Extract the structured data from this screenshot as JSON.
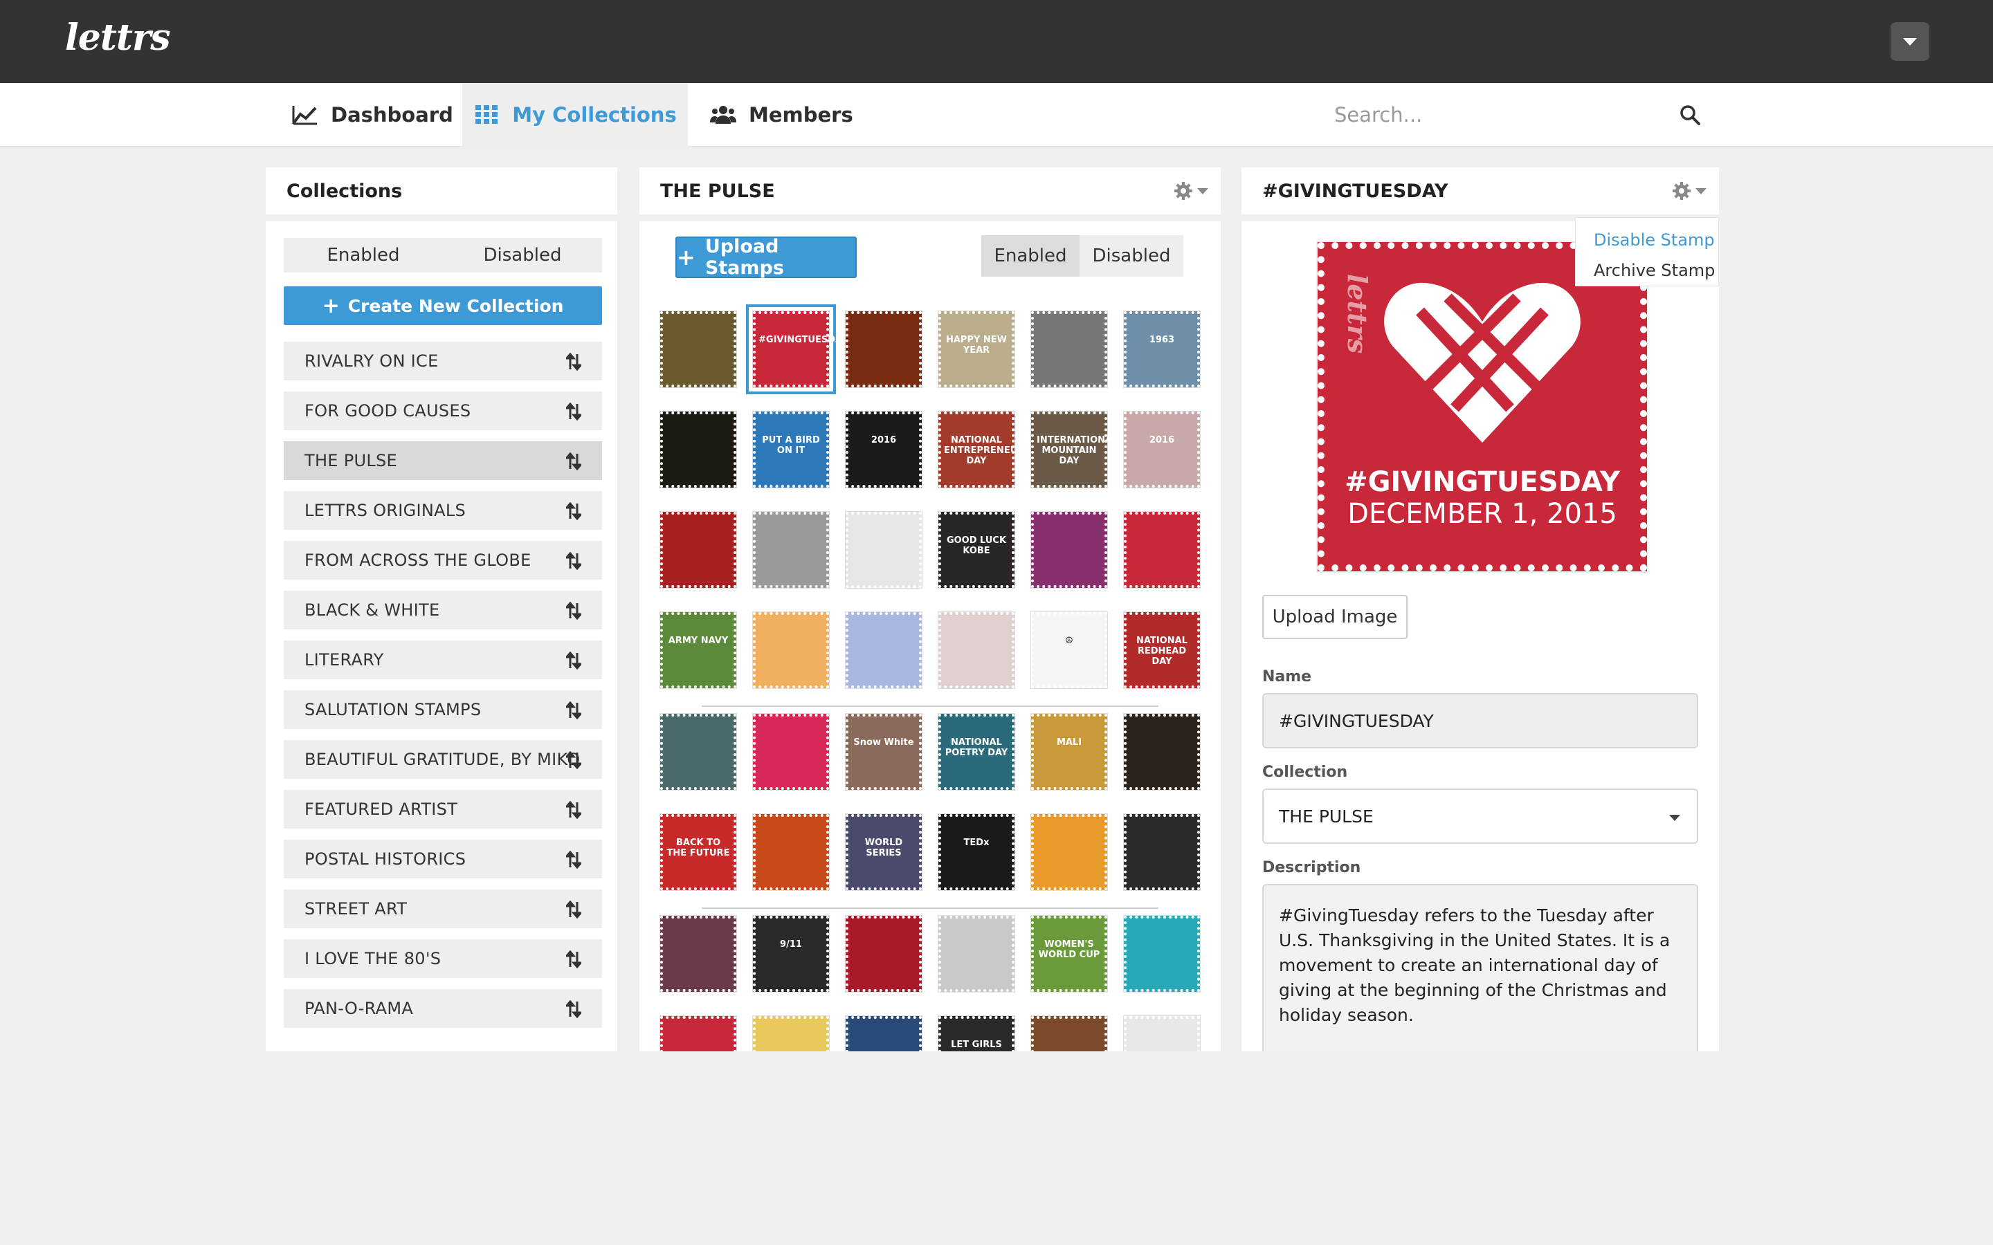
{
  "app": {
    "logo": "lettrs"
  },
  "nav": {
    "tabs": [
      {
        "label": "Dashboard"
      },
      {
        "label": "My Collections"
      },
      {
        "label": "Members"
      }
    ],
    "search_placeholder": "Search..."
  },
  "collections_panel": {
    "title": "Collections",
    "toggle": {
      "enabled": "Enabled",
      "disabled": "Disabled"
    },
    "create_label": "Create New Collection",
    "items": [
      "RIVALRY ON ICE",
      "FOR GOOD CAUSES",
      "THE PULSE",
      "LETTRS ORIGINALS",
      "FROM ACROSS THE GLOBE",
      "BLACK & WHITE",
      "LITERARY",
      "SALUTATION STAMPS",
      "BEAUTIFUL GRATITUDE, BY MIKO",
      "FEATURED ARTIST",
      "POSTAL HISTORICS",
      "STREET ART",
      "I LOVE THE 80'S",
      "PAN-O-RAMA"
    ],
    "active_item": "THE PULSE"
  },
  "stamps_panel": {
    "title": "THE PULSE",
    "upload_label": "Upload Stamps",
    "toggle": {
      "enabled": "Enabled",
      "disabled": "Disabled"
    },
    "stamp_rows": [
      [
        "#6b5a2e",
        "#c8283a",
        "#7a2c12",
        "#b9ad8c",
        "#777777",
        "#6f8fa8"
      ],
      [
        "#1d1a14",
        "#2d78b8",
        "#1b1b1b",
        "#a33b2c",
        "#6b5a48",
        "#c8a8a8"
      ],
      [
        "#a82020",
        "#9a9a9a",
        "#e6e6e6",
        "#2a2626",
        "#8a2f6e",
        "#c8283a"
      ],
      [
        "#5a8a3a",
        "#f0b060",
        "#a8b8e0",
        "#e0d0d0",
        "#f5f5f5",
        "#b22a2a"
      ],
      [
        "#4a6a6a",
        "#d8285a",
        "#8a6a5a",
        "#2a6a7a",
        "#c89a3a",
        "#2a241c"
      ],
      [
        "#c82a2a",
        "#c84a1a",
        "#4a4a6a",
        "#1a1a1a",
        "#e89a2a",
        "#2a2a2a"
      ],
      [
        "#6a3a4a",
        "#2a2a2a",
        "#a81a2a",
        "#c8c8c8",
        "#6a9a3a",
        "#2aa8b8"
      ],
      [
        "#c8283a",
        "#e8c85a",
        "#2a4a7a",
        "#2a2a2a",
        "#7a4a2a",
        "#e8e8e8"
      ]
    ],
    "stamp_texts": [
      [
        "",
        "#GIVINGTUESDAY",
        "",
        "HAPPY NEW YEAR",
        "",
        "1963"
      ],
      [
        "",
        "PUT A BIRD ON IT",
        "2016",
        "NATIONAL ENTREPRENEURS DAY",
        "INTERNATIONAL MOUNTAIN DAY",
        "2016"
      ],
      [
        "",
        "",
        "",
        "GOOD LUCK KOBE",
        "",
        ""
      ],
      [
        "ARMY NAVY",
        "",
        "",
        "",
        "☮",
        "NATIONAL REDHEAD DAY"
      ],
      [
        "",
        "",
        "Snow White",
        "NATIONAL POETRY DAY",
        "MALI",
        ""
      ],
      [
        "BACK TO THE FUTURE",
        "",
        "WORLD SERIES",
        "TEDx",
        "",
        ""
      ],
      [
        "",
        "9/11",
        "",
        "",
        "WOMEN'S WORLD CUP",
        ""
      ],
      [
        "",
        "",
        "",
        "LET GIRLS",
        "",
        ""
      ]
    ]
  },
  "stamp_detail": {
    "title": "#GIVINGTUESDAY",
    "menu": {
      "disable": "Disable Stamp",
      "archive": "Archive Stamp"
    },
    "preview": {
      "brand": "lettrs",
      "title": "#GIVINGTUESDAY",
      "date": "DECEMBER 1, 2015",
      "color": "#c8283a"
    },
    "upload_image_label": "Upload Image",
    "name_label": "Name",
    "name_value": "#GIVINGTUESDAY",
    "collection_label": "Collection",
    "collection_value": "THE PULSE",
    "description_label": "Description",
    "description_value": "#GivingTuesday refers to the Tuesday after U.S. Thanksgiving in the United States. It is a movement to create an international day of giving at the beginning of the Christmas and holiday season."
  },
  "colors": {
    "accent": "#3d9ad6",
    "topbar": "#333333",
    "selected_stamp": "#c8283a"
  }
}
